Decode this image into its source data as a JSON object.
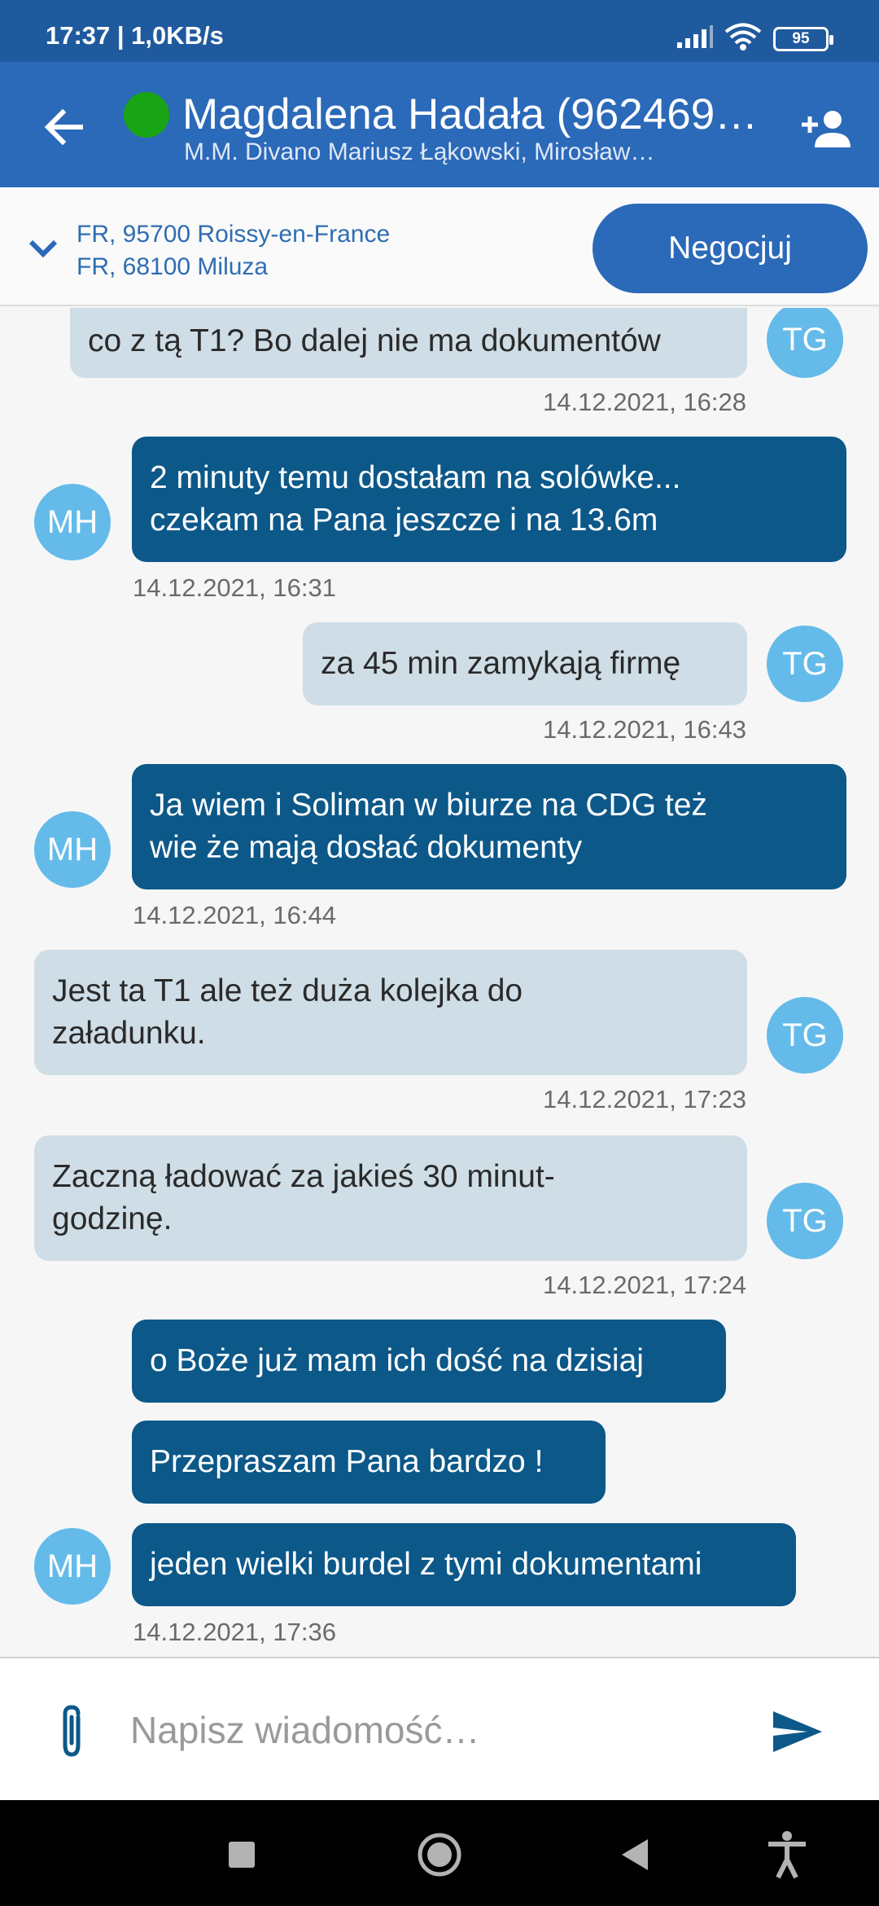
{
  "status_bar": {
    "time_speed": "17:37 | 1,0KB/s",
    "battery": "95",
    "icons": [
      "signal-icon",
      "wifi-icon",
      "battery-icon"
    ]
  },
  "header": {
    "contact_name": "Magdalena Hadała (962469…",
    "company": "M.M. Divano Mariusz Łąkowski, Mirosław…",
    "online_color": "#19a415",
    "icons": [
      "back-arrow-icon",
      "add-person-icon"
    ]
  },
  "route": {
    "origin": "FR, 95700 Roissy-en-France",
    "destination": "FR, 68100 Miluza",
    "negotiate_label": "Negocjuj",
    "icon": "chevron-down-icon"
  },
  "chat": {
    "messages": [
      {
        "text": "co z tą T1? Bo dalej nie ma dokumentów",
        "sender": "TG",
        "time": "14.12.2021, 16:28"
      },
      {
        "text_lines": [
          "2 minuty temu dostałam na solówke...",
          "czekam na Pana jeszcze i na 13.6m"
        ],
        "sender": "MH",
        "time": "14.12.2021, 16:31"
      },
      {
        "text": "za 45 min zamykają firmę",
        "sender": "TG",
        "time": "14.12.2021, 16:43"
      },
      {
        "text_lines": [
          "Ja wiem i Soliman w biurze na CDG też",
          "wie że mają dosłać dokumenty"
        ],
        "sender": "MH",
        "time": "14.12.2021, 16:44"
      },
      {
        "text_lines": [
          "Jest ta T1 ale też duża kolejka do",
          "załadunku."
        ],
        "sender": "TG",
        "time": "14.12.2021, 17:23"
      },
      {
        "text_lines": [
          "Zaczną ładować za jakieś 30 minut-",
          "godzinę."
        ],
        "sender": "TG",
        "time": "14.12.2021, 17:24"
      },
      {
        "text": "o Boże już mam ich dość na dzisiaj",
        "sender": "MH"
      },
      {
        "text": "Przepraszam Pana bardzo !",
        "sender": "MH"
      },
      {
        "text": "jeden wielki burdel z tymi dokumentami",
        "sender": "MH",
        "time": "14.12.2021, 17:36"
      }
    ]
  },
  "composer": {
    "placeholder": "Napisz wiadomość…",
    "icons": [
      "paperclip-icon",
      "send-icon"
    ]
  },
  "colors": {
    "status_bar": "#1f5a9e",
    "app_bar": "#2b69b9",
    "outgoing_bubble": "#0c5889",
    "incoming_bubble": "#cfdde6",
    "avatar": "#64bbe9"
  },
  "nav": {
    "icons": [
      "recents-square-icon",
      "home-circle-icon",
      "back-triangle-icon",
      "accessibility-icon"
    ]
  }
}
